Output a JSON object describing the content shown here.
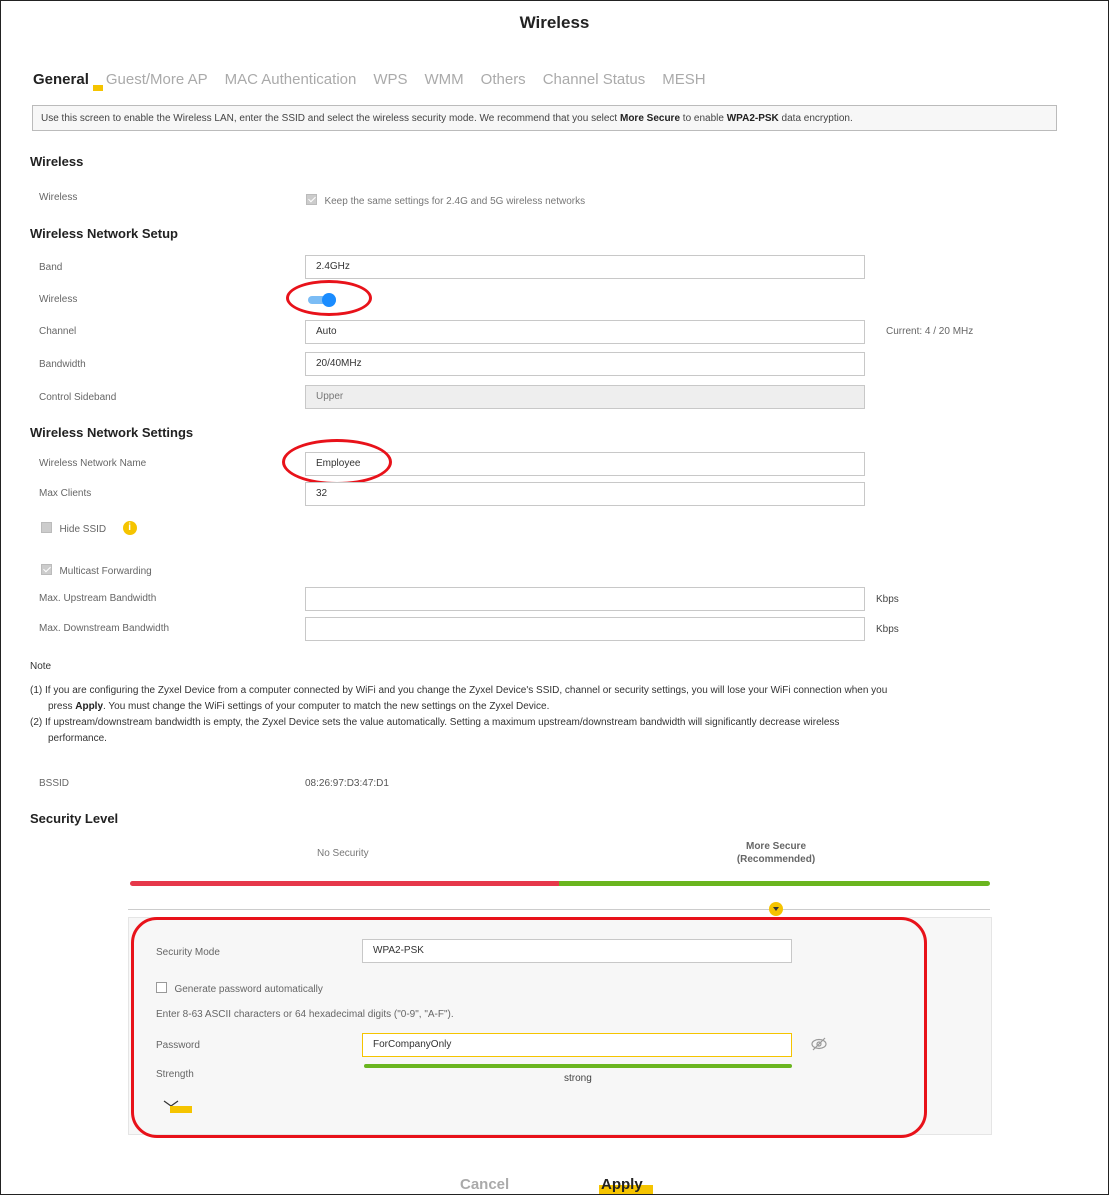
{
  "page": {
    "title": "Wireless"
  },
  "tabs": [
    {
      "label": "General"
    },
    {
      "label": "Guest/More AP"
    },
    {
      "label": "MAC Authentication"
    },
    {
      "label": "WPS"
    },
    {
      "label": "WMM"
    },
    {
      "label": "Others"
    },
    {
      "label": "Channel Status"
    },
    {
      "label": "MESH"
    }
  ],
  "description": {
    "part1": "Use this screen to enable the Wireless LAN, enter the SSID and select the wireless security mode. We recommend that you select ",
    "bold1": "More Secure",
    "part2": " to enable ",
    "bold2": "WPA2-PSK",
    "part3": " data encryption."
  },
  "wireless_section": {
    "heading": "Wireless",
    "wireless_label": "Wireless",
    "same_settings_label": "Keep the same settings for 2.4G and 5G wireless networks"
  },
  "setup_section": {
    "heading": "Wireless Network Setup",
    "band_label": "Band",
    "band_value": "2.4GHz",
    "wireless_label": "Wireless",
    "wireless_enabled": true,
    "channel_label": "Channel",
    "channel_value": "Auto",
    "channel_current": "Current: 4 / 20 MHz",
    "bandwidth_label": "Bandwidth",
    "bandwidth_value": "20/40MHz",
    "sideband_label": "Control Sideband",
    "sideband_value": "Upper"
  },
  "settings_section": {
    "heading": "Wireless Network Settings",
    "ssid_label": "Wireless Network Name",
    "ssid_value": "Employee",
    "max_clients_label": "Max Clients",
    "max_clients_value": "32",
    "hide_ssid_label": "Hide SSID",
    "multicast_label": "Multicast Forwarding",
    "upstream_label": "Max. Upstream Bandwidth",
    "downstream_label": "Max. Downstream Bandwidth",
    "unit": "Kbps"
  },
  "note": {
    "heading": "Note",
    "line1a": "(1) If you are configuring the Zyxel Device from a computer connected by WiFi and you change the Zyxel Device's SSID, channel or security settings, you will lose your WiFi connection when you",
    "line1b_pre": "press ",
    "line1b_bold": "Apply",
    "line1b_post": ". You must change the WiFi settings of your computer to match the new settings on the Zyxel Device.",
    "line2a": "(2) If upstream/downstream bandwidth is empty, the Zyxel Device sets the value automatically. Setting a maximum upstream/downstream bandwidth will significantly decrease wireless",
    "line2b": "performance."
  },
  "bssid": {
    "label": "BSSID",
    "value": "08:26:97:D3:47:D1"
  },
  "security": {
    "heading": "Security Level",
    "no_security": "No Security",
    "more_secure_line1": "More Secure",
    "more_secure_line2": "(Recommended)",
    "mode_label": "Security Mode",
    "mode_value": "WPA2-PSK",
    "generate_label": "Generate password automatically",
    "hint": "Enter 8-63 ASCII characters or 64 hexadecimal digits (\"0-9\", \"A-F\").",
    "password_label": "Password",
    "password_value": "ForCompanyOnly",
    "strength_label": "Strength",
    "strength_value": "strong"
  },
  "buttons": {
    "cancel": "Cancel",
    "apply": "Apply"
  },
  "colors": {
    "accent": "#f5c400",
    "toggle": "#1a8cff",
    "highlight": "#e8121a",
    "weak": "#e6384a",
    "strong": "#6ab51f"
  }
}
